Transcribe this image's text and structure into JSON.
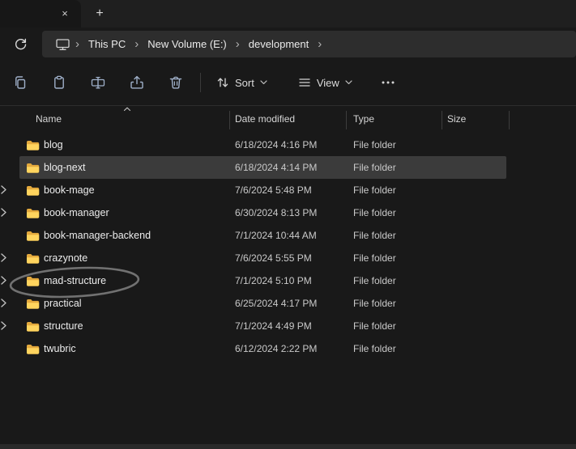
{
  "tab_bar": {
    "close_label": "×",
    "new_tab_label": "+"
  },
  "breadcrumb": {
    "items": [
      "This PC",
      "New Volume (E:)",
      "development"
    ]
  },
  "toolbar": {
    "sort_label": "Sort",
    "view_label": "View"
  },
  "columns": {
    "name": "Name",
    "date": "Date modified",
    "type": "Type",
    "size": "Size"
  },
  "files": [
    {
      "name": "blog",
      "date": "6/18/2024 4:16 PM",
      "type": "File folder",
      "size": "",
      "selected": false
    },
    {
      "name": "blog-next",
      "date": "6/18/2024 4:14 PM",
      "type": "File folder",
      "size": "",
      "selected": true
    },
    {
      "name": "book-mage",
      "date": "7/6/2024 5:48 PM",
      "type": "File folder",
      "size": "",
      "selected": false
    },
    {
      "name": "book-manager",
      "date": "6/30/2024 8:13 PM",
      "type": "File folder",
      "size": "",
      "selected": false
    },
    {
      "name": "book-manager-backend",
      "date": "7/1/2024 10:44 AM",
      "type": "File folder",
      "size": "",
      "selected": false
    },
    {
      "name": "crazynote",
      "date": "7/6/2024 5:55 PM",
      "type": "File folder",
      "size": "",
      "selected": false
    },
    {
      "name": "mad-structure",
      "date": "7/1/2024 5:10 PM",
      "type": "File folder",
      "size": "",
      "selected": false,
      "annotated": true
    },
    {
      "name": "practical",
      "date": "6/25/2024 4:17 PM",
      "type": "File folder",
      "size": "",
      "selected": false
    },
    {
      "name": "structure",
      "date": "7/1/2024 4:49 PM",
      "type": "File folder",
      "size": "",
      "selected": false
    },
    {
      "name": "twubric",
      "date": "6/12/2024 2:22 PM",
      "type": "File folder",
      "size": "",
      "selected": false
    }
  ],
  "icons": {
    "chevron": "›"
  },
  "colors": {
    "folder_yellow": "#ffd45e",
    "folder_yellow_dark": "#e3a93d",
    "selection_bg": "#3b3b3b",
    "annotation_stroke": "#787878",
    "toolbar_icon": "#9fb0c9"
  }
}
